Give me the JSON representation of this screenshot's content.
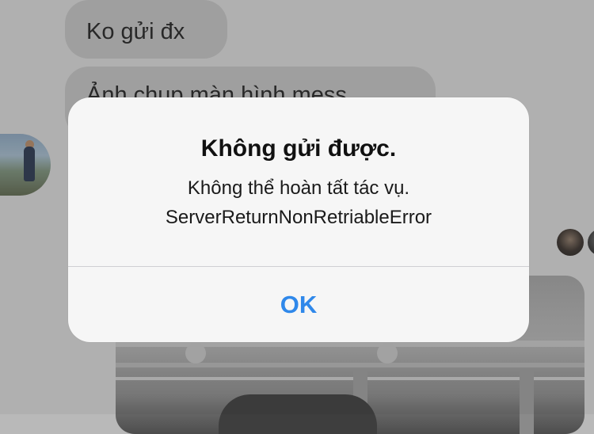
{
  "chat": {
    "messages": [
      {
        "text": "Ko gửi đx"
      },
      {
        "text": "Ảnh chụp màn hình mess"
      }
    ]
  },
  "alert": {
    "title": "Không gửi được.",
    "message_line_1": "Không thể hoàn tất tác vụ.",
    "message_line_2": "ServerReturnNonRetriableError",
    "ok_label": "OK"
  },
  "colors": {
    "accent": "#2f88ea",
    "alert_background": "#f6f6f6",
    "dimmed_background": "#b8b8b8",
    "bubble": "#a6a6a6"
  }
}
